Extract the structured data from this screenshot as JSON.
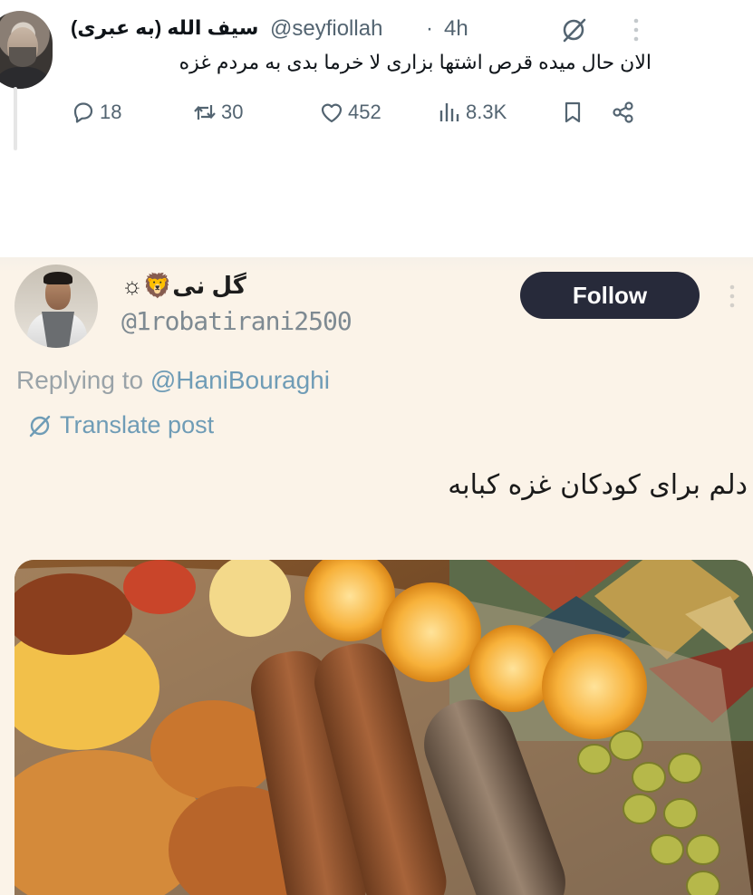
{
  "tweet1": {
    "display_name": "سیف الله (به عبری)",
    "handle": "@seyfiollah",
    "separator": "·",
    "time": "4h",
    "text": "الان حال میده قرص اشتها بزاری لا خرما بدی به مردم غزه",
    "stats": {
      "replies": "18",
      "reposts": "30",
      "likes": "452",
      "views": "8.3K"
    }
  },
  "tweet2": {
    "display_name": "گل نی🦁☼",
    "handle": "@1robatirani2500",
    "follow_label": "Follow",
    "replying_prefix": "Replying to",
    "replying_to": "@HaniBouraghi",
    "translate_label": "Translate post",
    "text": "دلم برای کودکان غزه کبابه",
    "photo_description": "platter-of-kebab-fish-rice-lemons-olives"
  },
  "icons": {
    "grok": "grok-icon",
    "more": "more-dots-icon",
    "reply": "reply-icon",
    "repost": "repost-icon",
    "like": "heart-icon",
    "views": "views-icon",
    "bookmark": "bookmark-icon",
    "share": "share-icon",
    "translate": "translate-icon"
  },
  "colors": {
    "follow_bg": "#272a3a",
    "link": "#6f9cb6",
    "secondary_text": "#536471",
    "panel_bg": "#fbf3e8"
  }
}
